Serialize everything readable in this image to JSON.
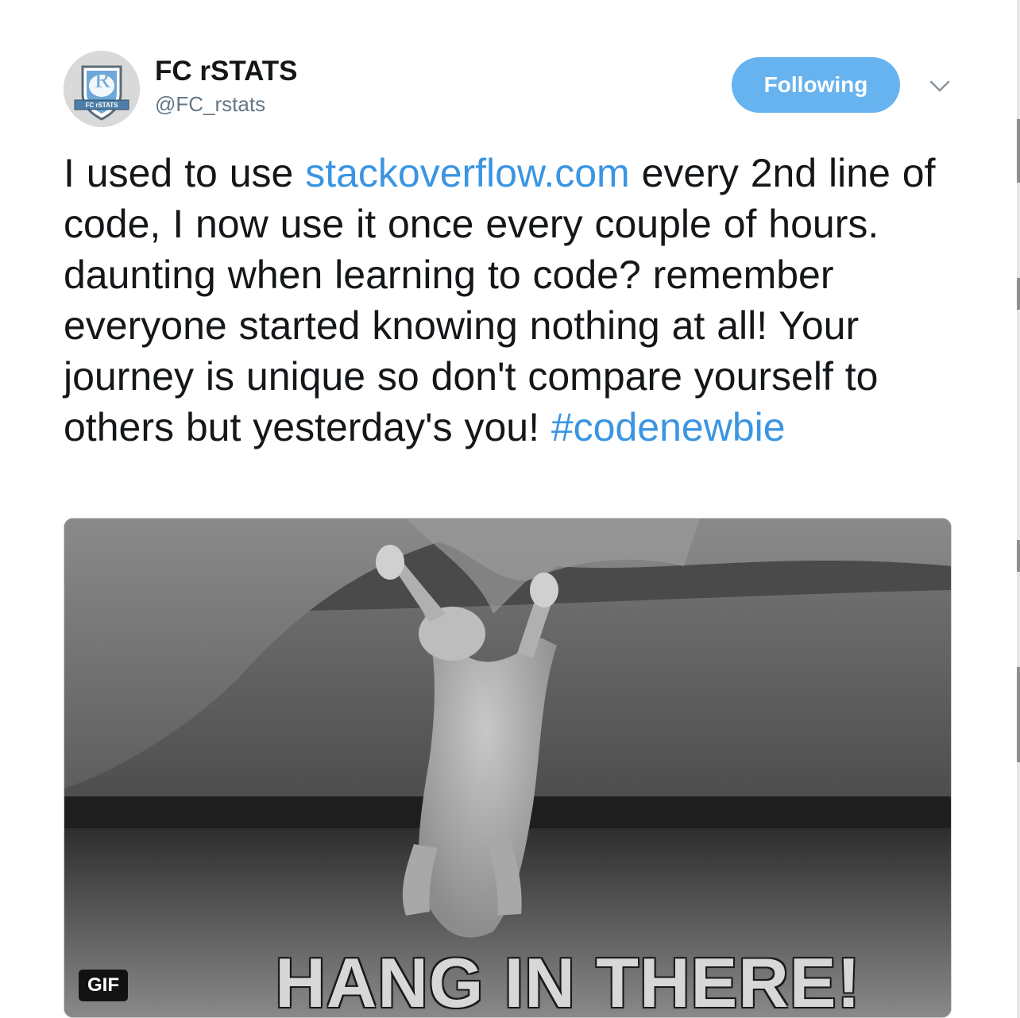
{
  "author": {
    "display_name": "FC rSTATS",
    "handle": "@FC_rstats",
    "avatar_letter": "R",
    "avatar_banner": "FC rSTATS"
  },
  "actions": {
    "follow_label": "Following",
    "more_icon": "chevron-down-icon"
  },
  "tweet": {
    "text_before_link": "I used to use ",
    "link": "stackoverflow.com",
    "text_after_link": " every 2nd line of code, I now use it once every couple of hours. daunting when learning to code? remember everyone started knowing nothing at all! Your journey is unique so don't compare yourself to others but yesterday's you! ",
    "hashtag": "#codenewbie"
  },
  "media": {
    "caption": "HANG IN THERE!",
    "badge": "GIF"
  },
  "colors": {
    "accent": "#3a95e2",
    "follow_button": "#66b3ef",
    "text": "#14171a",
    "secondary_text": "#657786"
  }
}
